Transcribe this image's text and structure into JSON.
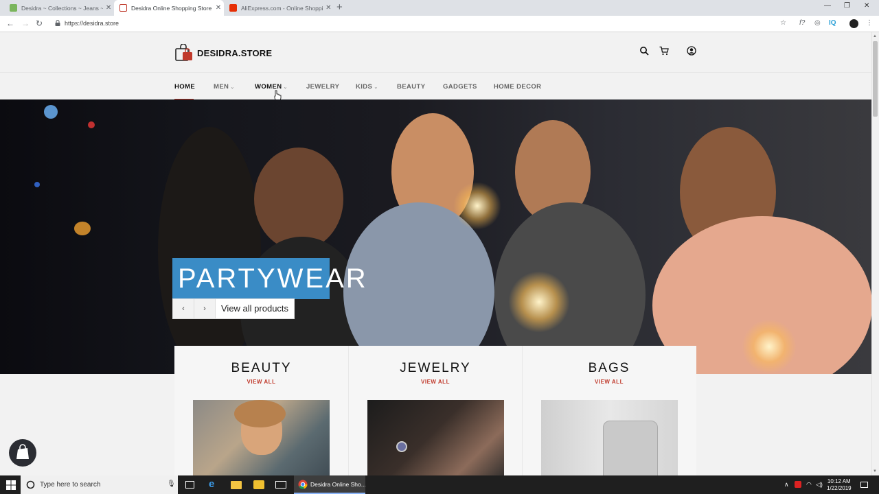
{
  "browser": {
    "tabs": [
      {
        "title": "Desidra ~ Collections ~ Jeans ~ ",
        "close": "✕",
        "favicon_color": "#7ab55c"
      },
      {
        "title": "Desidra Online Shopping Store",
        "close": "✕",
        "favicon_color": "#c0392b"
      },
      {
        "title": "AliExpress.com - Online Shoppin",
        "close": "✕",
        "favicon_color": "#e62e04"
      }
    ],
    "new_tab": "+",
    "window_controls": {
      "minimize": "—",
      "maximize": "❐",
      "close": "✕"
    },
    "url": "https://desidra.store",
    "extensions": [
      "f?",
      "IQ"
    ]
  },
  "site": {
    "logo_text": "DESIDRA.STORE",
    "nav": [
      {
        "label": "HOME",
        "active": true,
        "dropdown": false
      },
      {
        "label": "MEN",
        "active": false,
        "dropdown": true
      },
      {
        "label": "WOMEN",
        "active": false,
        "dropdown": true
      },
      {
        "label": "JEWELRY",
        "active": false,
        "dropdown": false
      },
      {
        "label": "KIDS",
        "active": false,
        "dropdown": true
      },
      {
        "label": "BEAUTY",
        "active": false,
        "dropdown": false
      },
      {
        "label": "GADGETS",
        "active": false,
        "dropdown": false
      },
      {
        "label": "HOME DECOR",
        "active": false,
        "dropdown": false
      }
    ],
    "chevron": "⌄",
    "hero": {
      "title": "PARTYWEAR",
      "prev": "‹",
      "next": "›",
      "cta": "View all products"
    },
    "collections": [
      {
        "title": "BEAUTY",
        "link": "VIEW ALL"
      },
      {
        "title": "JEWELRY",
        "link": "VIEW ALL"
      },
      {
        "title": "BAGS",
        "link": "VIEW ALL"
      }
    ]
  },
  "taskbar": {
    "search_placeholder": "Type here to search",
    "chrome_task_label": "Desidra Online Sho...",
    "time": "10:12 AM",
    "date": "1/22/2019"
  },
  "colors": {
    "accent_red": "#c0392b",
    "hero_title_bg": "#3a8cc6"
  }
}
